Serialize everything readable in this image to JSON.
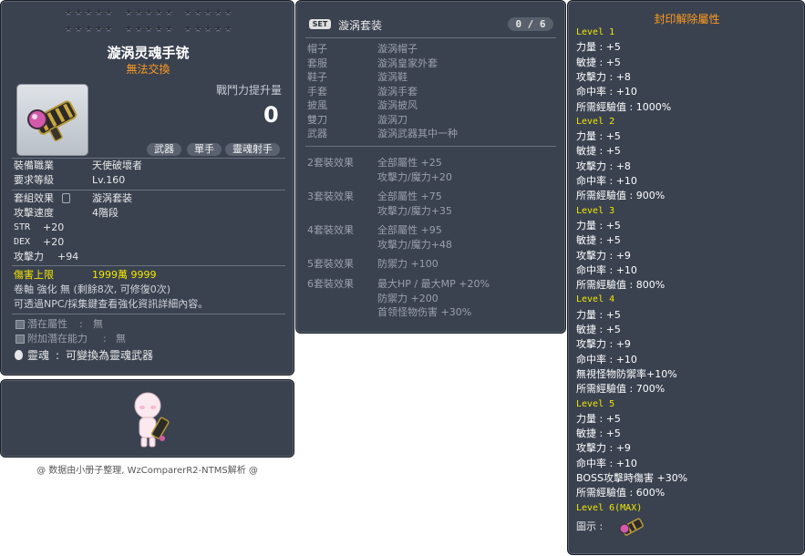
{
  "item_id": "01222129",
  "left": {
    "stars": [
      "★★★★★",
      "★★★★★",
      "★★★★★",
      "★★★★★",
      "★★★★★",
      "★★★★★"
    ],
    "title": "漩涡灵魂手铳",
    "untradeable": "無法交換",
    "power_label": "戰鬥力提升量",
    "power_value": "0",
    "tags": [
      "武器",
      "單手",
      "靈魂射手"
    ],
    "job_label": "裝備職業",
    "job_value": "天使破壞者",
    "level_label": "要求等級",
    "level_value": "Lv.160",
    "set_label": "套組效果",
    "set_value": "漩涡套装",
    "speed_label": "攻擊速度",
    "speed_value": "4階段",
    "str_label": "STR",
    "str_value": "+20",
    "dex_label": "DEX",
    "dex_value": "+20",
    "atk_label": "攻擊力",
    "atk_value": "+94",
    "dmgcap_label": "傷害上限",
    "dmgcap_value": "1999萬 9999",
    "scroll_line": "卷軸 強化 無 (剩餘8次, 可修復0次)",
    "npc_line": "可透過NPC/採集鍵查看強化資訊詳細內容。",
    "potential_label": "潛在屬性",
    "potential_value": "無",
    "bonus_label": "附加潛在能力",
    "bonus_value": "無",
    "soul_label": "靈魂",
    "soul_value": "可變換為靈魂武器"
  },
  "footer": "@ 数据由小册子整理, WzComparerR2-NTMS解析 @",
  "middle": {
    "set_badge": "SET",
    "set_name": "漩涡套装",
    "count": "0 / 6",
    "parts": [
      {
        "slot": "帽子",
        "name": "漩涡帽子"
      },
      {
        "slot": "套服",
        "name": "漩涡皇家外套"
      },
      {
        "slot": "鞋子",
        "name": "漩涡鞋"
      },
      {
        "slot": "手套",
        "name": "漩涡手套"
      },
      {
        "slot": "披風",
        "name": "漩涡披风"
      },
      {
        "slot": "雙刀",
        "name": "漩涡刀"
      },
      {
        "slot": "武器",
        "name": "漩涡武器其中一种"
      }
    ],
    "effects": [
      {
        "label": "2套裝效果",
        "lines": [
          "全部屬性 +25",
          "攻擊力/魔力+20"
        ]
      },
      {
        "label": "3套裝效果",
        "lines": [
          "全部屬性 +75",
          "攻擊力/魔力+35"
        ]
      },
      {
        "label": "4套裝效果",
        "lines": [
          "全部屬性 +95",
          "攻擊力/魔力+48"
        ]
      },
      {
        "label": "5套裝效果",
        "lines": [
          "防禦力 +100"
        ]
      },
      {
        "label": "6套裝效果",
        "lines": [
          "最大HP / 最大MP +20%",
          "防禦力 +200",
          "首领怪物伤害 +30%"
        ]
      }
    ]
  },
  "right": {
    "title": "封印解除屬性",
    "levels": [
      {
        "level": "Level 1",
        "lines": [
          "力量 : +5",
          "敏捷 : +5",
          "攻擊力 : +8",
          "命中率 : +10",
          "所需經驗值 : 1000%"
        ]
      },
      {
        "level": "Level 2",
        "lines": [
          "力量 : +5",
          "敏捷 : +5",
          "攻擊力 : +8",
          "命中率 : +10",
          "所需經驗值 : 900%"
        ]
      },
      {
        "level": "Level 3",
        "lines": [
          "力量 : +5",
          "敏捷 : +5",
          "攻擊力 : +9",
          "命中率 : +10",
          "所需經驗值 : 800%"
        ]
      },
      {
        "level": "Level 4",
        "lines": [
          "力量 : +5",
          "敏捷 : +5",
          "攻擊力 : +9",
          "命中率 : +10",
          "無視怪物防禦率+10%",
          "所需經驗值 : 700%"
        ]
      },
      {
        "level": "Level 5",
        "lines": [
          "力量 : +5",
          "敏捷 : +5",
          "攻擊力 : +9",
          "命中率 : +10",
          "BOSS攻擊時傷害 +30%",
          "所需經驗值 : 600%"
        ]
      }
    ],
    "max_level": "Level 6(MAX)",
    "image_label": "圖示 :"
  }
}
